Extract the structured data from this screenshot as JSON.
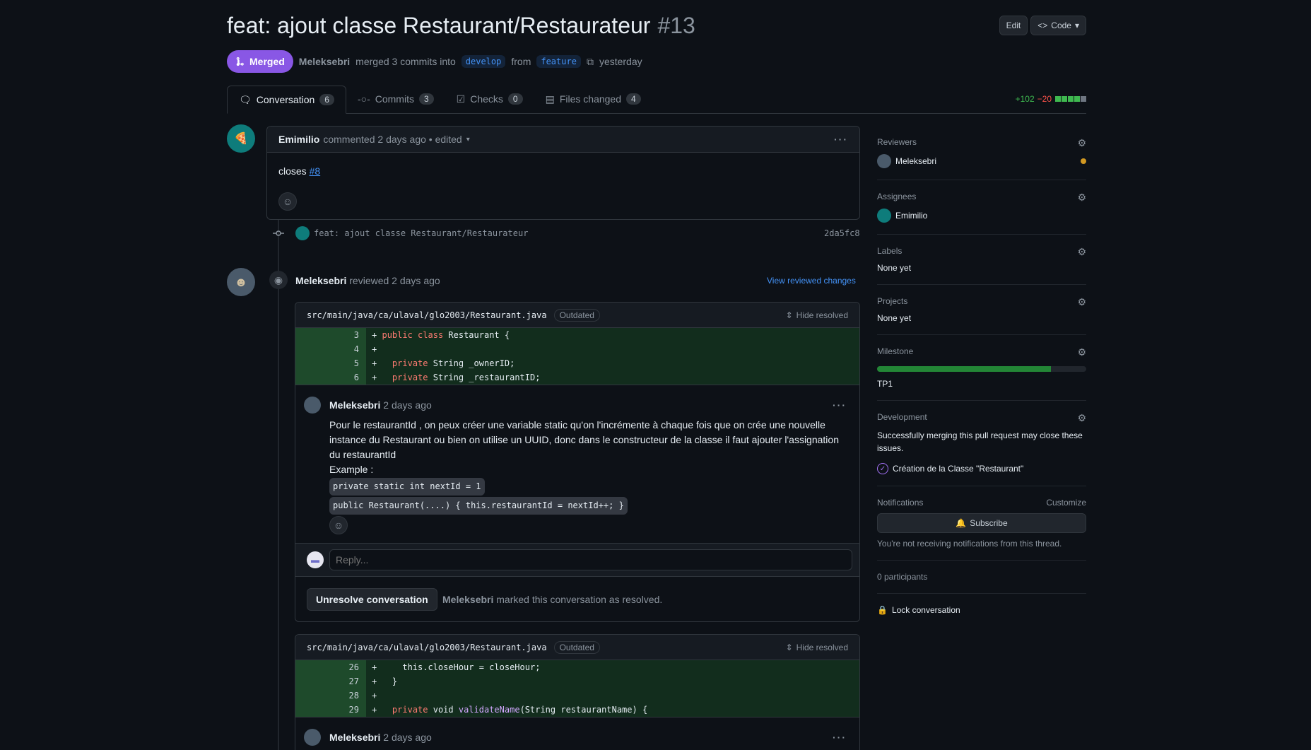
{
  "pr": {
    "title": "feat: ajout classe Restaurant/Restaurateur",
    "number": "#13",
    "status": "Merged",
    "author": "Meleksebri",
    "merge_text": "merged 3 commits into",
    "base_branch": "develop",
    "from_text": "from",
    "head_branch": "feature",
    "when": "yesterday"
  },
  "header_actions": {
    "edit": "Edit",
    "code": "Code"
  },
  "tabs": [
    {
      "label": "Conversation",
      "count": "6"
    },
    {
      "label": "Commits",
      "count": "3"
    },
    {
      "label": "Checks",
      "count": "0"
    },
    {
      "label": "Files changed",
      "count": "4"
    }
  ],
  "diffstat": {
    "additions": "+102",
    "deletions": "−20"
  },
  "first_comment": {
    "author": "Emimilio",
    "meta": "commented 2 days ago • edited",
    "body_prefix": "closes",
    "issue_link": "#8"
  },
  "commit": {
    "message": "feat: ajout classe Restaurant/Restaurateur",
    "sha": "2da5fc8"
  },
  "review": {
    "author": "Meleksebri",
    "meta": "reviewed 2 days ago",
    "view_changes": "View reviewed changes"
  },
  "thread1": {
    "file": "src/main/java/ca/ulaval/glo2003/Restaurant.java",
    "outdated": "Outdated",
    "hide_resolved": "Hide resolved",
    "lines": [
      {
        "num": "3",
        "sign": "+",
        "code": " public class Restaurant {"
      },
      {
        "num": "4",
        "sign": "+",
        "code": ""
      },
      {
        "num": "5",
        "sign": "+",
        "code": "   private String _ownerID;"
      },
      {
        "num": "6",
        "sign": "+",
        "code": "   private String _restaurantID;"
      }
    ],
    "comment_author": "Meleksebri",
    "comment_time": "2 days ago",
    "comment_body": "Pour le restaurantId , on peux créer une variable static qu'on l'incrémente à chaque fois que on crée une nouvelle instance du Restaurant ou bien on utilise un UUID, donc dans le constructeur de la classe il faut ajouter l'assignation du restaurantId",
    "example_label": "Example :",
    "code1": "private static int nextId = 1",
    "code2": "public Restaurant(....) { this.restaurantId = nextId++; }",
    "reply_placeholder": "Reply...",
    "unresolve": "Unresolve conversation",
    "resolved_by": "Meleksebri",
    "resolved_text": "marked this conversation as resolved."
  },
  "thread2": {
    "file": "src/main/java/ca/ulaval/glo2003/Restaurant.java",
    "outdated": "Outdated",
    "hide_resolved": "Hide resolved",
    "lines": [
      {
        "num": "26",
        "sign": "+",
        "code": "     this.closeHour = closeHour;"
      },
      {
        "num": "27",
        "sign": "+",
        "code": "   }"
      },
      {
        "num": "28",
        "sign": "+",
        "code": ""
      },
      {
        "num": "29",
        "sign": "+",
        "code": "   private void validateName(String restaurantName) {"
      }
    ],
    "comment_author": "Meleksebri",
    "comment_time": "2 days ago"
  },
  "sidebar": {
    "reviewers_title": "Reviewers",
    "reviewer": "Meleksebri",
    "assignees_title": "Assignees",
    "assignee": "Emimilio",
    "labels_title": "Labels",
    "labels_value": "None yet",
    "projects_title": "Projects",
    "projects_value": "None yet",
    "milestone_title": "Milestone",
    "milestone_name": "TP1",
    "milestone_progress": 0.83,
    "development_title": "Development",
    "development_text": "Successfully merging this pull request may close these issues.",
    "development_issue": "Création de la Classe \"Restaurant\"",
    "notifications_title": "Notifications",
    "customize": "Customize",
    "subscribe": "Subscribe",
    "notifications_text": "You're not receiving notifications from this thread.",
    "participants": "0 participants",
    "lock": "Lock conversation"
  },
  "colors": {
    "merged": "#8957e5",
    "link": "#4493f8",
    "add": "#3fb950",
    "delete": "#f85149",
    "pending": "#d29922"
  }
}
